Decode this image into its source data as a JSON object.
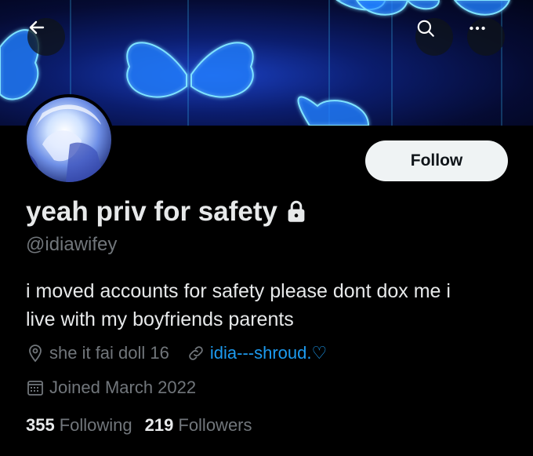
{
  "header": {
    "back_icon": "arrow-left-icon",
    "search_icon": "search-icon",
    "more_icon": "more-horizontal-icon"
  },
  "profile": {
    "display_name": "yeah priv for safety",
    "protected_icon": "lock-icon",
    "handle": "@idiawifey",
    "follow_label": "Follow",
    "bio_line1": "i moved accounts for safety please dont dox me i",
    "bio_line2": "live with my boyfriends parents",
    "location": "she it fai doll 16",
    "website": "idia---shroud.♡",
    "joined": "Joined March 2022",
    "following_count": "355",
    "following_label": "Following",
    "followers_count": "219",
    "followers_label": "Followers"
  },
  "colors": {
    "background": "#000000",
    "text_primary": "#e7e9ea",
    "text_secondary": "#71767b",
    "link": "#1d9bf0",
    "follow_button_bg": "#eff3f4",
    "banner_glow": "#2aa8ff"
  }
}
